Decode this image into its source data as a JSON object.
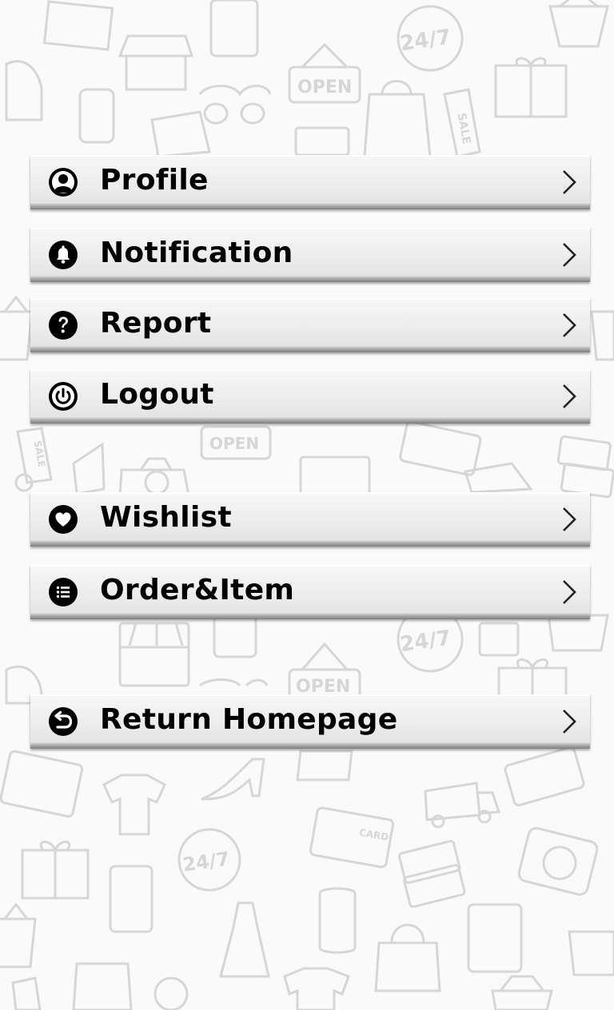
{
  "menu": {
    "items": [
      {
        "label": "Profile",
        "icon": "user-icon"
      },
      {
        "label": "Notification",
        "icon": "bell-icon"
      },
      {
        "label": "Report",
        "icon": "question-icon"
      },
      {
        "label": "Logout",
        "icon": "power-icon"
      },
      {
        "label": "Wishlist",
        "icon": "heart-icon"
      },
      {
        "label": "Order&Item",
        "icon": "list-icon"
      },
      {
        "label": "Return Homepage",
        "icon": "return-icon"
      }
    ]
  },
  "background": {
    "signs": [
      "OPEN",
      "OPEN",
      "OPEN",
      "24/7",
      "24/7",
      "24/7",
      "SALE",
      "SALE",
      "CARD"
    ]
  },
  "colors": {
    "button_face": "#ececec",
    "button_shadow": "#7d7d7d",
    "text": "#000000",
    "doodle": "#d6d6d6"
  }
}
